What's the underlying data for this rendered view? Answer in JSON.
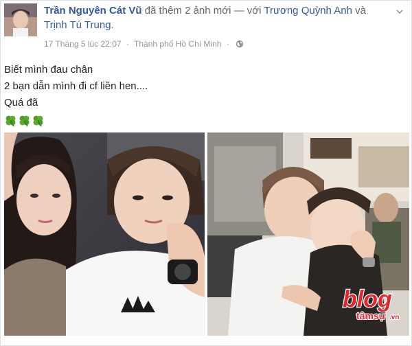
{
  "post": {
    "author": "Trần Nguyên Cát Vũ",
    "action": "đã thêm 2 ảnh mới — với",
    "tagged_1": "Trương Quỳnh Anh",
    "conjunction": "và",
    "tagged_2": "Trịnh Tú Trung",
    "period": ".",
    "date": "17 Tháng 5 lúc 22:07",
    "separator": "·",
    "location": "Thành phố Hồ Chí Minh",
    "privacy_icon": "globe-icon",
    "lines": [
      "Biết mình đau chân",
      "2 bạn dẫn mình đi cf liền hen....",
      "Quá đã"
    ],
    "emoji": [
      "four-leaf-clover-icon",
      "four-leaf-clover-icon",
      "four-leaf-clover-icon"
    ]
  },
  "watermark": {
    "brand_main": "blog",
    "brand_sub": "tâmsự",
    "brand_tld": ".vn"
  },
  "colors": {
    "link": "#365899",
    "meta": "#90949c",
    "text": "#1d2129",
    "watermark_red": "#e0262f"
  }
}
